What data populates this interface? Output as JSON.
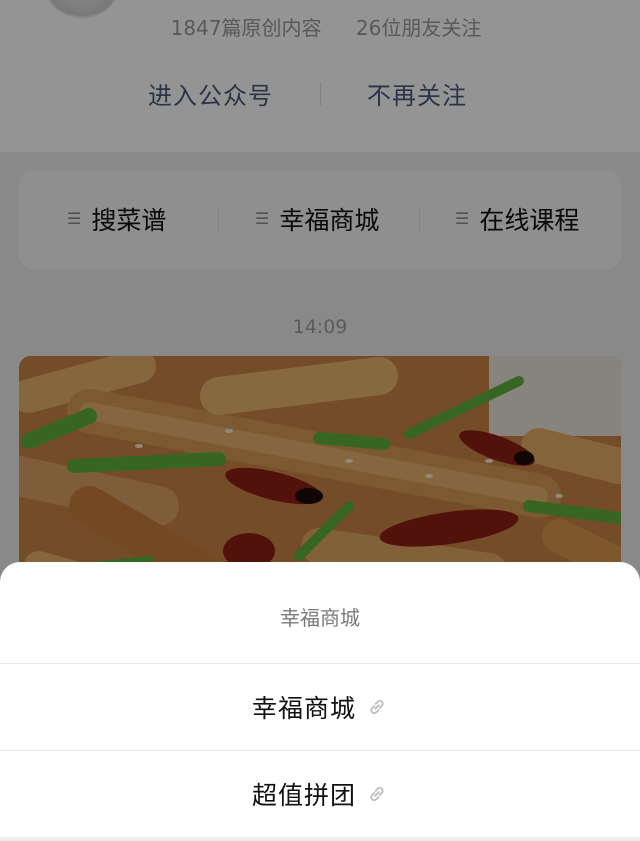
{
  "profile": {
    "stats_articles": "1847篇原创内容",
    "stats_friends": "26位朋友关注",
    "enter_label": "进入公众号",
    "unfollow_label": "不再关注"
  },
  "menu": {
    "items": [
      {
        "label": "搜菜谱",
        "icon": "menu-lines-icon"
      },
      {
        "label": "幸福商城",
        "icon": "menu-lines-icon"
      },
      {
        "label": "在线课程",
        "icon": "menu-lines-icon"
      }
    ]
  },
  "feed": {
    "time": "14:09",
    "image": "fried-potato-strips-with-chili-photo"
  },
  "sheet": {
    "title": "幸福商城",
    "options": [
      {
        "label": "幸福商城",
        "icon": "mini-program-link-icon"
      },
      {
        "label": "超值拼团",
        "icon": "mini-program-link-icon"
      }
    ]
  },
  "colors": {
    "action_text": "#4a5b7a",
    "overlay": "rgba(0,0,0,0.42)",
    "sheet_bg": "#ffffff"
  }
}
